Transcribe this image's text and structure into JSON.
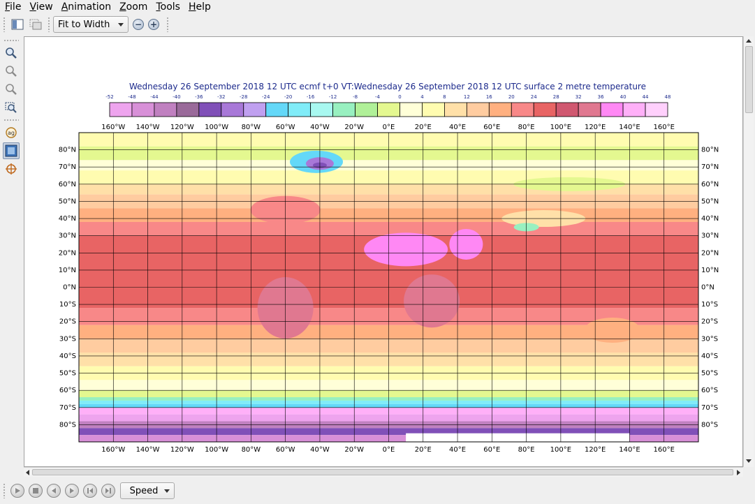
{
  "menu": [
    "File",
    "View",
    "Animation",
    "Zoom",
    "Tools",
    "Help"
  ],
  "menu_mnemonic": [
    "F",
    "V",
    "A",
    "Z",
    "T",
    "H"
  ],
  "toolbar": {
    "zoom_combo_value": "Fit to Width"
  },
  "sidebar": {
    "icons": [
      "zoom-in-icon",
      "zoom-out-icon",
      "zoom-reset-icon",
      "zoom-window-icon",
      "magnifier-icon",
      "layer-view-icon",
      "cursor-data-icon"
    ],
    "active_index": 5
  },
  "plot": {
    "title": "Wednesday 26 September 2018 12 UTC ecmf t+0 VT:Wednesday 26 September 2018 12 UTC surface  2 metre temperature",
    "legend_values": [
      "-52",
      "-48",
      "-44",
      "-40",
      "-36",
      "-32",
      "-28",
      "-24",
      "-20",
      "-16",
      "-12",
      "-8",
      "-4",
      "0",
      "4",
      "8",
      "12",
      "16",
      "20",
      "24",
      "28",
      "32",
      "36",
      "40",
      "44",
      "48"
    ],
    "legend_colors": [
      "#eea4ee",
      "#d890d8",
      "#c080c0",
      "#9a6a9a",
      "#8050b8",
      "#a878d8",
      "#c0a0f0",
      "#64d8f8",
      "#80ecf8",
      "#a8f8f0",
      "#98f0c0",
      "#b0f098",
      "#e4f890",
      "#ffffd8",
      "#fffcb0",
      "#ffe0a8",
      "#ffcca0",
      "#ffb080",
      "#f88888",
      "#e86464",
      "#d05870",
      "#e07890",
      "#ff88f4",
      "#ffb0f8",
      "#ffd0fc"
    ],
    "x_labels": [
      "160°W",
      "140°W",
      "120°W",
      "100°W",
      "80°W",
      "60°W",
      "40°W",
      "20°W",
      "0°E",
      "20°E",
      "40°E",
      "60°E",
      "80°E",
      "100°E",
      "120°E",
      "140°E",
      "160°E"
    ],
    "y_labels": [
      "80°N",
      "70°N",
      "60°N",
      "50°N",
      "40°N",
      "30°N",
      "20°N",
      "10°N",
      "0°N",
      "10°S",
      "20°S",
      "30°S",
      "40°S",
      "50°S",
      "60°S",
      "70°S",
      "80°S"
    ]
  },
  "animation": {
    "buttons": [
      "play-icon",
      "stop-icon",
      "step-back-icon",
      "step-forward-icon",
      "first-frame-icon",
      "last-frame-icon"
    ],
    "speed_label": "Speed"
  }
}
